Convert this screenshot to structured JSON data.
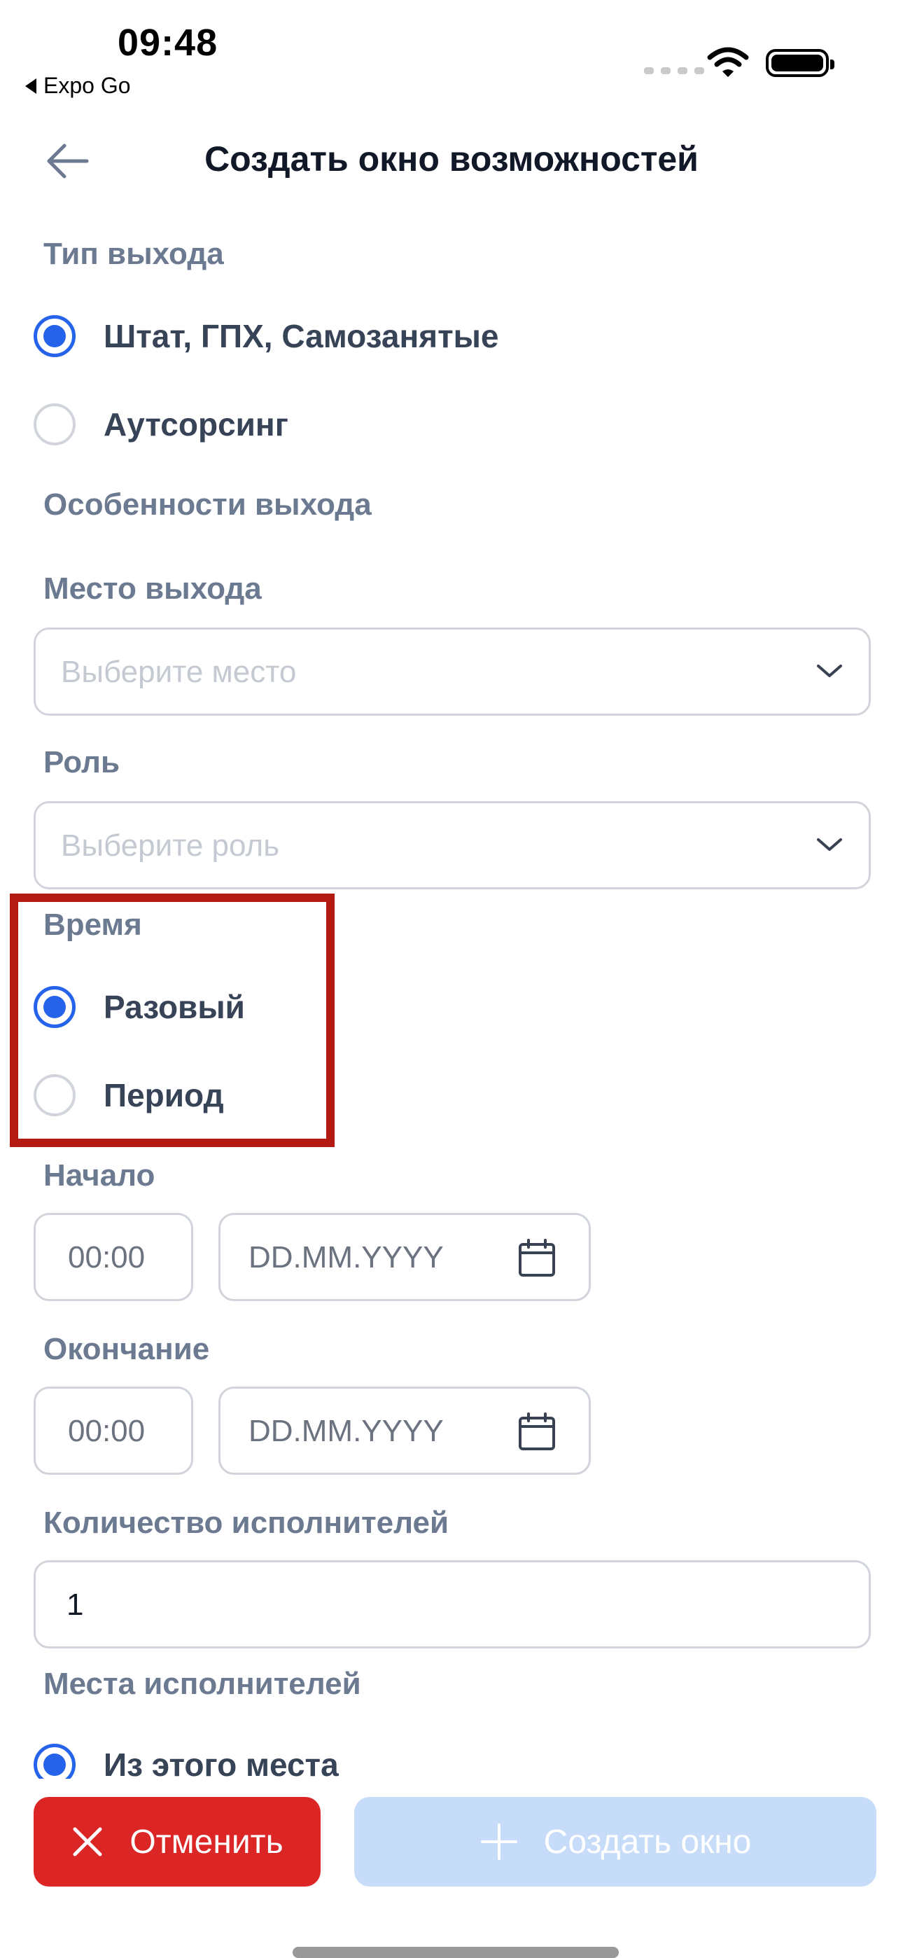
{
  "status_bar": {
    "time": "09:48",
    "back_app": "Expo Go"
  },
  "header": {
    "title": "Создать окно возможностей"
  },
  "exit_type": {
    "label": "Тип выхода",
    "options": [
      {
        "label": "Штат, ГПХ, Самозанятые",
        "selected": true
      },
      {
        "label": "Аутсорсинг",
        "selected": false
      }
    ]
  },
  "features_label": "Особенности выхода",
  "place": {
    "label": "Место выхода",
    "placeholder": "Выберите место"
  },
  "role": {
    "label": "Роль",
    "placeholder": "Выберите роль"
  },
  "time": {
    "label": "Время",
    "options": [
      {
        "label": "Разовый",
        "selected": true
      },
      {
        "label": "Период",
        "selected": false
      }
    ]
  },
  "start": {
    "label": "Начало",
    "time_placeholder": "00:00",
    "date_placeholder": "DD.MM.YYYY"
  },
  "end": {
    "label": "Окончание",
    "time_placeholder": "00:00",
    "date_placeholder": "DD.MM.YYYY"
  },
  "performers_count": {
    "label": "Количество исполнителей",
    "value": "1"
  },
  "performer_places": {
    "label": "Места исполнителей",
    "option": "Из этого места",
    "selected": true
  },
  "actions": {
    "cancel": "Отменить",
    "create": "Создать окно"
  },
  "colors": {
    "accent": "#2563eb",
    "danger": "#dc2626",
    "disabled": "#c7dcf9",
    "highlight": "#b21a12"
  }
}
